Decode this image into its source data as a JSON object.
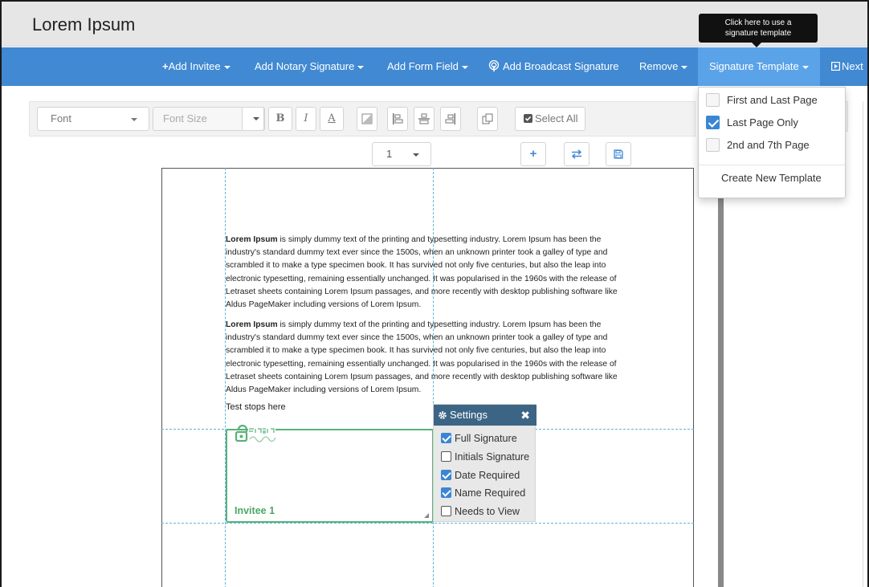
{
  "app": {
    "title": "Lorem Ipsum"
  },
  "tooltip": {
    "line1": "Click here to use a",
    "line2": "signature template"
  },
  "nav": {
    "add_invitee": "Add Invitee",
    "add_notary_signature": "Add Notary Signature",
    "add_form_field": "Add Form Field",
    "add_broadcast_signature": "Add Broadcast Signature",
    "remove": "Remove",
    "signature_template": "Signature Template",
    "next": "Next"
  },
  "toolbar": {
    "font_value": "Font",
    "font_size_placeholder": "Font Size",
    "bold": "B",
    "italic": "I",
    "underline": "A",
    "select_all": "Select All"
  },
  "pager": {
    "page": "1"
  },
  "document": {
    "paragraph_bold": "Lorem Ipsum",
    "paragraph_text": " is simply dummy text of the printing and typesetting industry. Lorem Ipsum has been the industry's standard dummy text ever since the 1500s, when an unknown printer took a galley of type and scrambled it to make a type specimen book. It has survived not only five centuries, but also the leap into electronic typesetting, remaining essentially unchanged. It was popularised in the 1960s with the release of Letraset sheets containing Lorem Ipsum passages, and more recently with desktop publishing software like Aldus PageMaker including versions of Lorem Ipsum.",
    "test_stops": "Test stops here"
  },
  "signature_box": {
    "invitee": "Invitee 1",
    "logo_text": "SECURED Signing"
  },
  "settings": {
    "title": "Settings",
    "close": "✖",
    "options": [
      {
        "label": "Full Signature",
        "checked": true
      },
      {
        "label": "Initials Signature",
        "checked": false
      },
      {
        "label": "Date Required",
        "checked": true
      },
      {
        "label": "Name Required",
        "checked": true
      },
      {
        "label": "Needs to View",
        "checked": false
      }
    ]
  },
  "template_menu": {
    "items": [
      {
        "label": "First and Last Page",
        "checked": false
      },
      {
        "label": "Last Page Only",
        "checked": true
      },
      {
        "label": "2nd and 7th Page",
        "checked": false
      }
    ],
    "create_new": "Create New Template"
  },
  "colors": {
    "navbar": "#4189d2",
    "navbar_active": "#5aa3e8",
    "settings_header": "#3c6585",
    "signature_green": "#5ab17a",
    "checkbox_blue": "#3a86d4"
  }
}
